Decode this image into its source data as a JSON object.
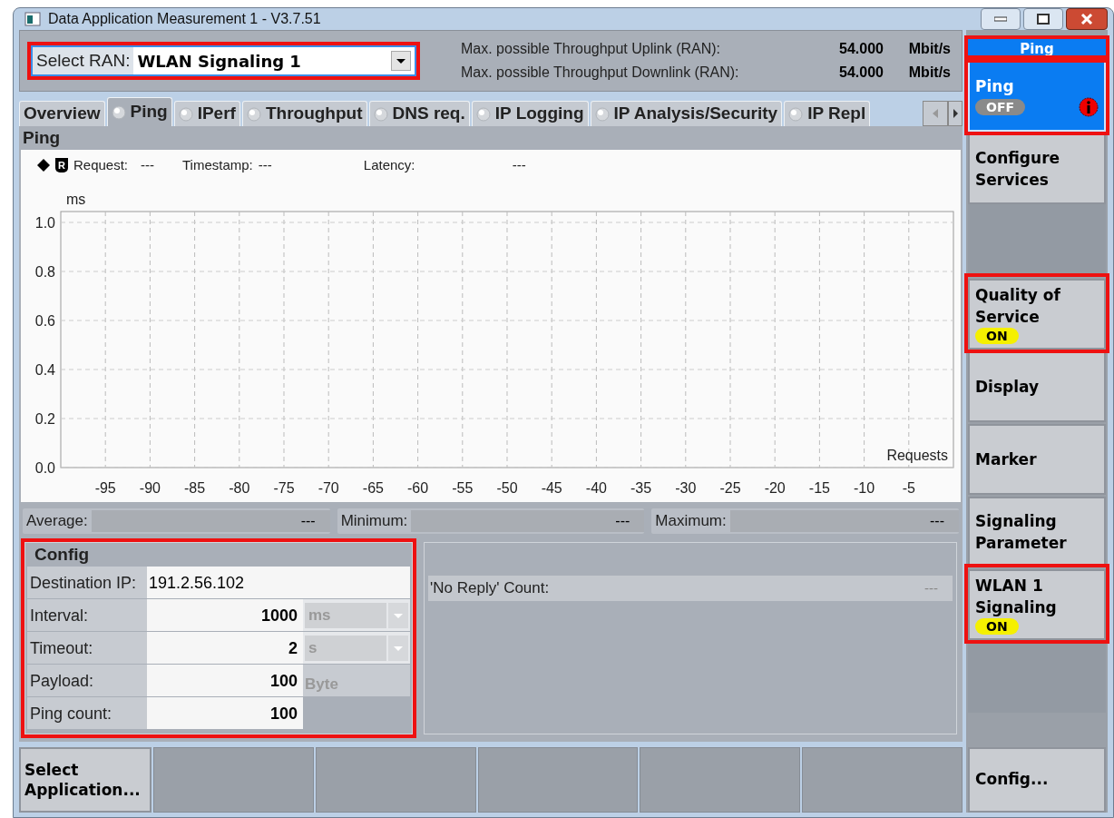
{
  "window": {
    "title": "Data Application Measurement 1 - V3.7.51"
  },
  "ran": {
    "label": "Select RAN:",
    "value": "WLAN Signaling 1",
    "highlighted": true
  },
  "throughput": [
    {
      "label": "Max. possible Throughput Uplink (RAN):",
      "value": "54.000",
      "unit": "Mbit/s"
    },
    {
      "label": "Max. possible Throughput Downlink (RAN):",
      "value": "54.000",
      "unit": "Mbit/s"
    }
  ],
  "tabs": [
    {
      "label": "Overview",
      "selected": false,
      "indicator": false
    },
    {
      "label": "Ping",
      "selected": true,
      "indicator": true
    },
    {
      "label": "IPerf",
      "selected": false,
      "indicator": true
    },
    {
      "label": "Throughput",
      "selected": false,
      "indicator": true
    },
    {
      "label": "DNS req.",
      "selected": false,
      "indicator": true
    },
    {
      "label": "IP Logging",
      "selected": false,
      "indicator": true
    },
    {
      "label": "IP Analysis/Security",
      "selected": false,
      "indicator": true
    },
    {
      "label": "IP Repl",
      "selected": false,
      "indicator": true
    }
  ],
  "section_title": "Ping",
  "readout": {
    "marker": "R",
    "request_label": "Request:",
    "request": "---",
    "timestamp_label": "Timestamp:",
    "timestamp": "---",
    "latency_label": "Latency:",
    "latency": "---"
  },
  "chart_data": {
    "type": "line",
    "grid": true,
    "ylabel": "ms",
    "xlabel": "Requests",
    "xlim": [
      -100,
      0
    ],
    "ylim": [
      0,
      1
    ],
    "xticks": [
      -95,
      -90,
      -85,
      -80,
      -75,
      -70,
      -65,
      -60,
      -55,
      -50,
      -45,
      -40,
      -35,
      -30,
      -25,
      -20,
      -15,
      -10,
      -5
    ],
    "yticks": [
      {
        "value": 0,
        "label": "0.0"
      },
      {
        "value": 0.2,
        "label": "0.2"
      },
      {
        "value": 0.4,
        "label": "0.4"
      },
      {
        "value": 0.6,
        "label": "0.6"
      },
      {
        "value": 0.8,
        "label": "0.8"
      },
      {
        "value": 1,
        "label": "1.0"
      }
    ]
  },
  "stats": [
    {
      "label": "Average:",
      "value": "---"
    },
    {
      "label": "Minimum:",
      "value": "---"
    },
    {
      "label": "Maximum:",
      "value": "---"
    }
  ],
  "config": {
    "title": "Config",
    "highlighted": true,
    "rows": [
      {
        "kind": "text",
        "label": "Destination IP:",
        "value": "191.2.56.102"
      },
      {
        "kind": "dropdown",
        "label": "Interval:",
        "value": "1000",
        "unit": "ms"
      },
      {
        "kind": "dropdown",
        "label": "Timeout:",
        "value": "2",
        "unit": "s"
      },
      {
        "kind": "unit",
        "label": "Payload:",
        "value": "100",
        "unit": "Byte"
      },
      {
        "kind": "plain",
        "label": "Ping count:",
        "value": "100"
      }
    ]
  },
  "no_reply": {
    "label": "'No Reply' Count:",
    "value": "---"
  },
  "softkeys": [
    {
      "kind": "header",
      "label": "Ping",
      "highlighted": true
    },
    {
      "kind": "key",
      "label": "Ping",
      "selected": true,
      "highlighted": true,
      "status": {
        "label": "OFF",
        "on": false
      },
      "info": true
    },
    {
      "kind": "key",
      "label": "Configure Services",
      "selected": false,
      "highlighted": false
    },
    {
      "kind": "blank"
    },
    {
      "kind": "key",
      "label": "Quality of Service",
      "selected": false,
      "highlighted": true,
      "status": {
        "label": "ON",
        "on": true
      }
    },
    {
      "kind": "key",
      "label": "Display",
      "selected": false,
      "highlighted": false
    },
    {
      "kind": "key",
      "label": "Marker",
      "selected": false,
      "highlighted": false
    },
    {
      "kind": "key",
      "label": "Signaling Parameter",
      "selected": false,
      "highlighted": false
    },
    {
      "kind": "key",
      "label": "WLAN 1 Signaling",
      "selected": false,
      "highlighted": true,
      "status": {
        "label": "ON",
        "on": true
      }
    },
    {
      "kind": "blank"
    }
  ],
  "bottom_keys": [
    {
      "kind": "key",
      "label": "Select Application..."
    },
    {
      "kind": "blank"
    },
    {
      "kind": "blank"
    },
    {
      "kind": "blank"
    },
    {
      "kind": "blank"
    },
    {
      "kind": "blank"
    }
  ],
  "corner_key": {
    "label": "Config..."
  }
}
